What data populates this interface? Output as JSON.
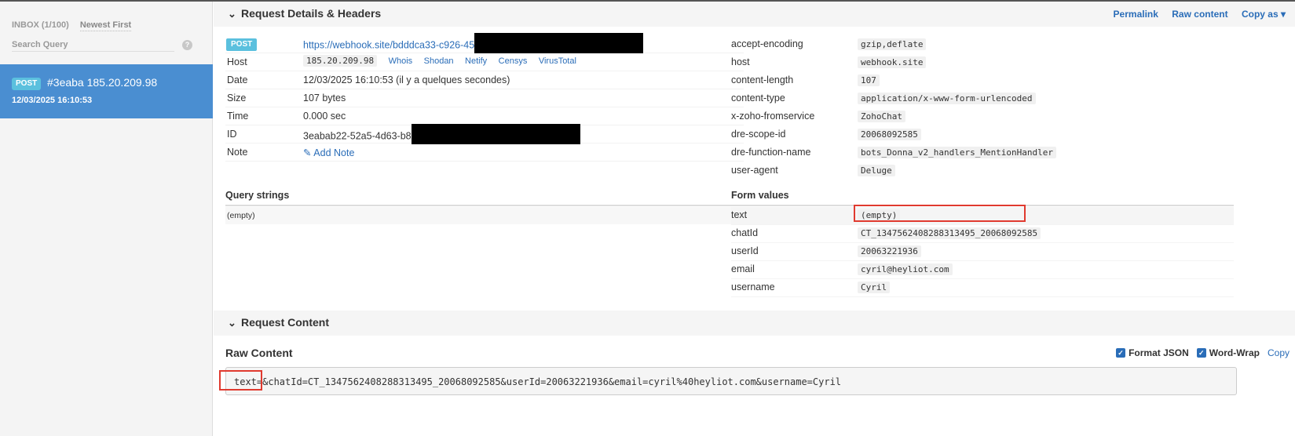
{
  "sidebar": {
    "inbox_label": "INBOX (1/100)",
    "sort_label": "Newest First",
    "search_placeholder": "Search Query",
    "help_glyph": "?",
    "request": {
      "method": "POST",
      "title": "#3eaba 185.20.209.98",
      "date": "12/03/2025 16:10:53"
    }
  },
  "details": {
    "section_title": "Request Details & Headers",
    "actions": [
      "Permalink",
      "Raw content",
      "Copy as ▾"
    ],
    "method": "POST",
    "url": "https://webhook.site/bdddca33-c926-45",
    "host_label": "Host",
    "host_ip": "185.20.209.98",
    "ip_links": [
      "Whois",
      "Shodan",
      "Netify",
      "Censys",
      "VirusTotal"
    ],
    "date_label": "Date",
    "date_value": "12/03/2025 16:10:53 (il y a quelques secondes)",
    "size_label": "Size",
    "size_value": "107 bytes",
    "time_label": "Time",
    "time_value": "0.000 sec",
    "id_label": "ID",
    "id_value": "3eabab22-52a5-4d63-b8",
    "note_label": "Note",
    "note_action": "Add Note"
  },
  "headers": [
    {
      "key": "accept-encoding",
      "value": "gzip,deflate"
    },
    {
      "key": "host",
      "value": "webhook.site"
    },
    {
      "key": "content-length",
      "value": "107"
    },
    {
      "key": "content-type",
      "value": "application/x-www-form-urlencoded"
    },
    {
      "key": "x-zoho-fromservice",
      "value": "ZohoChat"
    },
    {
      "key": "dre-scope-id",
      "value": "20068092585"
    },
    {
      "key": "dre-function-name",
      "value": "bots_Donna_v2_handlers_MentionHandler"
    },
    {
      "key": "user-agent",
      "value": "Deluge"
    }
  ],
  "query_strings": {
    "title": "Query strings",
    "value": "(empty)"
  },
  "form_values": {
    "title": "Form values",
    "rows": [
      {
        "key": "text",
        "value": "(empty)"
      },
      {
        "key": "chatId",
        "value": "CT_1347562408288313495_20068092585"
      },
      {
        "key": "userId",
        "value": "20063221936"
      },
      {
        "key": "email",
        "value": "cyril@heyliot.com"
      },
      {
        "key": "username",
        "value": "Cyril"
      }
    ]
  },
  "content": {
    "section_title": "Request Content",
    "raw_title": "Raw Content",
    "format_json_label": "Format JSON",
    "format_json_checked": true,
    "word_wrap_label": "Word-Wrap",
    "word_wrap_checked": true,
    "copy_label": "Copy",
    "raw_body": "text=&chatId=CT_1347562408288313495_20068092585&userId=20063221936&email=cyril%40heyliot.com&username=Cyril"
  },
  "colors": {
    "accent": "#2a6db8",
    "selected": "#4a8ed1",
    "badge": "#5bc0de",
    "highlight": "#e03a2f"
  }
}
